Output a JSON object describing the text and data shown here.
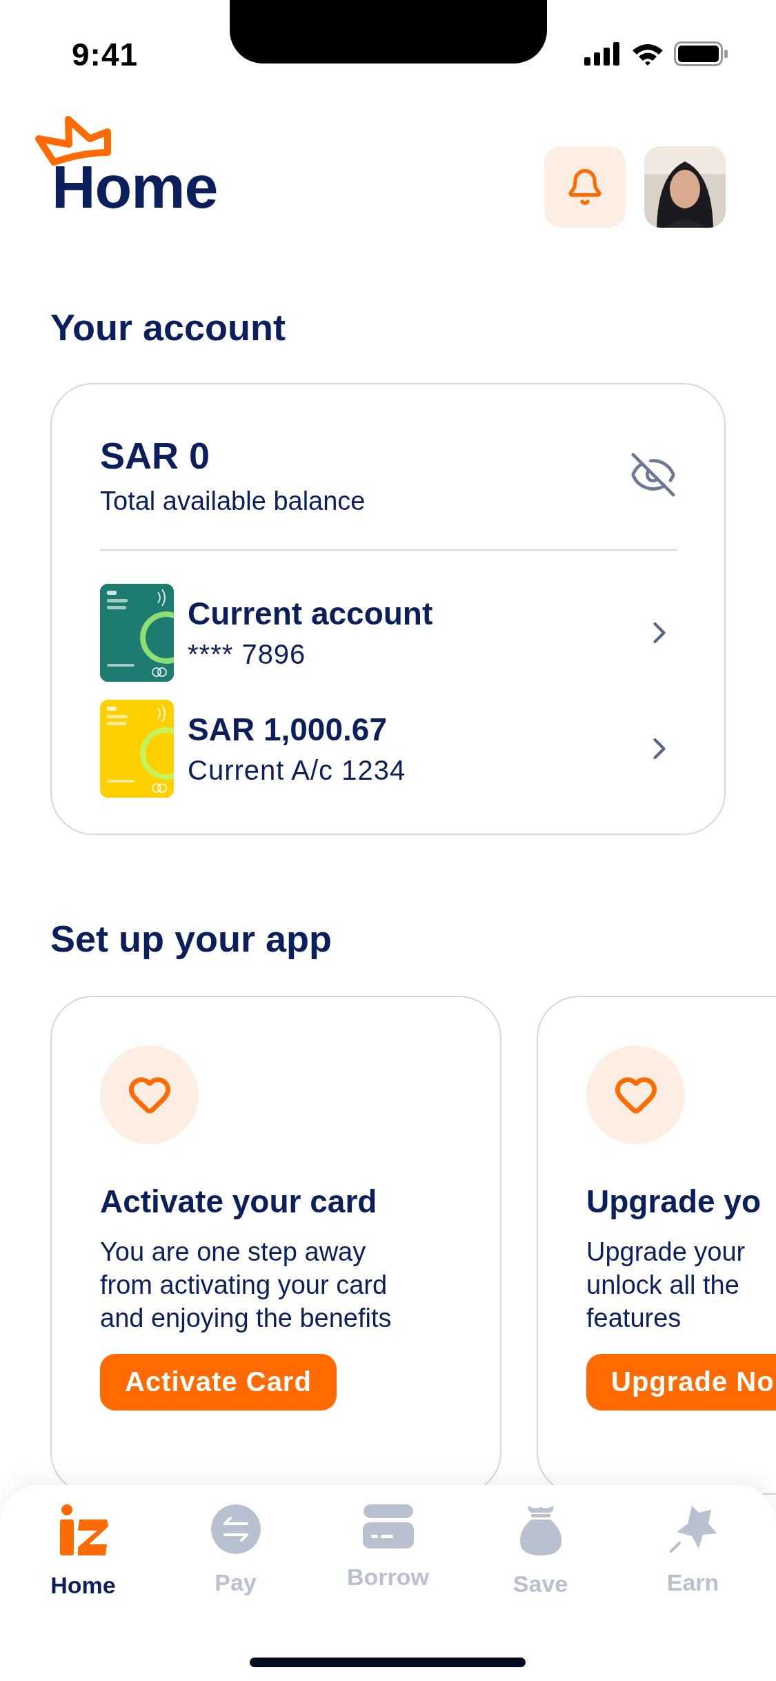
{
  "status_bar": {
    "time": "9:41"
  },
  "header": {
    "title": "Home"
  },
  "account_section": {
    "title": "Your account",
    "balance": "SAR 0",
    "balance_label": "Total available balance",
    "accounts": [
      {
        "title": "Current account",
        "subtitle": "**** 7896",
        "color": "#1d7b6f"
      },
      {
        "title": "SAR 1,000.67",
        "subtitle": "Current A/c 1234",
        "color": "#ffd000"
      }
    ]
  },
  "setup_section": {
    "title": "Set up your app",
    "cards": [
      {
        "title": "Activate your card",
        "body_lines": [
          "You are one step away",
          "from activating your card",
          "and enjoying the benefits"
        ],
        "button": "Activate Card"
      },
      {
        "title": "Upgrade yo",
        "body_lines": [
          "Upgrade your",
          "unlock all the",
          "features"
        ],
        "button": "Upgrade No"
      }
    ]
  },
  "tab_bar": {
    "items": [
      {
        "label": "Home",
        "selected": true
      },
      {
        "label": "Pay",
        "selected": false
      },
      {
        "label": "Borrow",
        "selected": false
      },
      {
        "label": "Save",
        "selected": false
      },
      {
        "label": "Earn",
        "selected": false
      }
    ]
  }
}
